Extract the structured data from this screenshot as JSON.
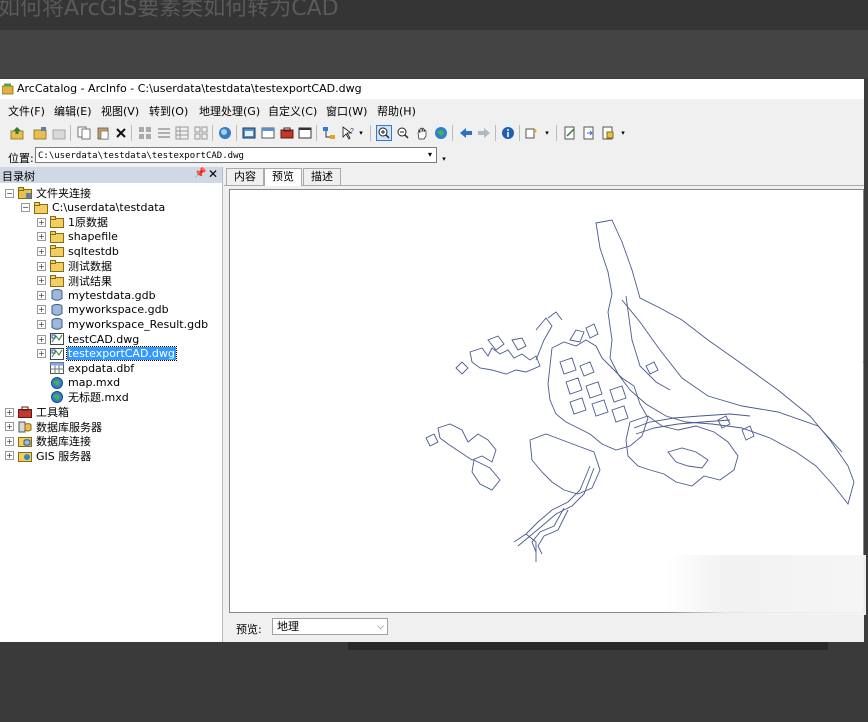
{
  "background": {
    "top_text": "如何将ArcGIS要素类如何转为CAD"
  },
  "window": {
    "title": "ArcCatalog - ArcInfo - C:\\userdata\\testdata\\testexportCAD.dwg"
  },
  "menu": [
    {
      "label": "文件(F)"
    },
    {
      "label": "编辑(E)"
    },
    {
      "label": "视图(V)"
    },
    {
      "label": "转到(O)"
    },
    {
      "label": "地理处理(G)"
    },
    {
      "label": "自定义(C)"
    },
    {
      "label": "窗口(W)"
    },
    {
      "label": "帮助(H)"
    }
  ],
  "location": {
    "label": "位置:",
    "value": "C:\\userdata\\testdata\\testexportCAD.dwg"
  },
  "catalog_tree": {
    "title": "目录树",
    "items": [
      {
        "label": "文件夹连接",
        "icon": "folder-connection-icon",
        "expander": "⊟"
      },
      {
        "label": "C:\\userdata\\testdata",
        "icon": "folder-icon",
        "expander": "⊟"
      },
      {
        "label": "1原数据",
        "icon": "folder-icon",
        "expander": "⊞"
      },
      {
        "label": "shapefile",
        "icon": "folder-icon",
        "expander": "⊞"
      },
      {
        "label": "sqltestdb",
        "icon": "folder-icon",
        "expander": "⊞"
      },
      {
        "label": "测试数据",
        "icon": "folder-icon",
        "expander": "⊞"
      },
      {
        "label": "测试结果",
        "icon": "folder-icon",
        "expander": "⊞"
      },
      {
        "label": "mytestdata.gdb",
        "icon": "geodatabase-icon",
        "expander": "⊞"
      },
      {
        "label": "myworkspace.gdb",
        "icon": "geodatabase-icon",
        "expander": "⊞"
      },
      {
        "label": "myworkspace_Result.gdb",
        "icon": "geodatabase-icon",
        "expander": "⊞"
      },
      {
        "label": "testCAD.dwg",
        "icon": "cad-dataset-icon",
        "expander": "⊞"
      },
      {
        "label": "testexportCAD.dwg",
        "icon": "cad-dataset-icon",
        "expander": "⊞",
        "selected": true
      },
      {
        "label": "expdata.dbf",
        "icon": "table-icon",
        "expander": ""
      },
      {
        "label": "map.mxd",
        "icon": "map-document-icon",
        "expander": ""
      },
      {
        "label": "无标题.mxd",
        "icon": "map-document-icon",
        "expander": ""
      },
      {
        "label": "工具箱",
        "icon": "toolbox-icon",
        "expander": "⊞"
      },
      {
        "label": "数据库服务器",
        "icon": "database-server-icon",
        "expander": "⊞"
      },
      {
        "label": "数据库连接",
        "icon": "database-connection-icon",
        "expander": "⊞"
      },
      {
        "label": "GIS 服务器",
        "icon": "gis-server-icon",
        "expander": "⊞"
      }
    ]
  },
  "tabs": [
    {
      "label": "内容",
      "active": false
    },
    {
      "label": "预览",
      "active": true
    },
    {
      "label": "描述",
      "active": false
    }
  ],
  "preview": {
    "label": "预览:",
    "mode": "地理"
  },
  "colors": {
    "selection": "#3399ff",
    "map_line": "#4a5a8c",
    "tree_header": "#cfd8e4"
  }
}
